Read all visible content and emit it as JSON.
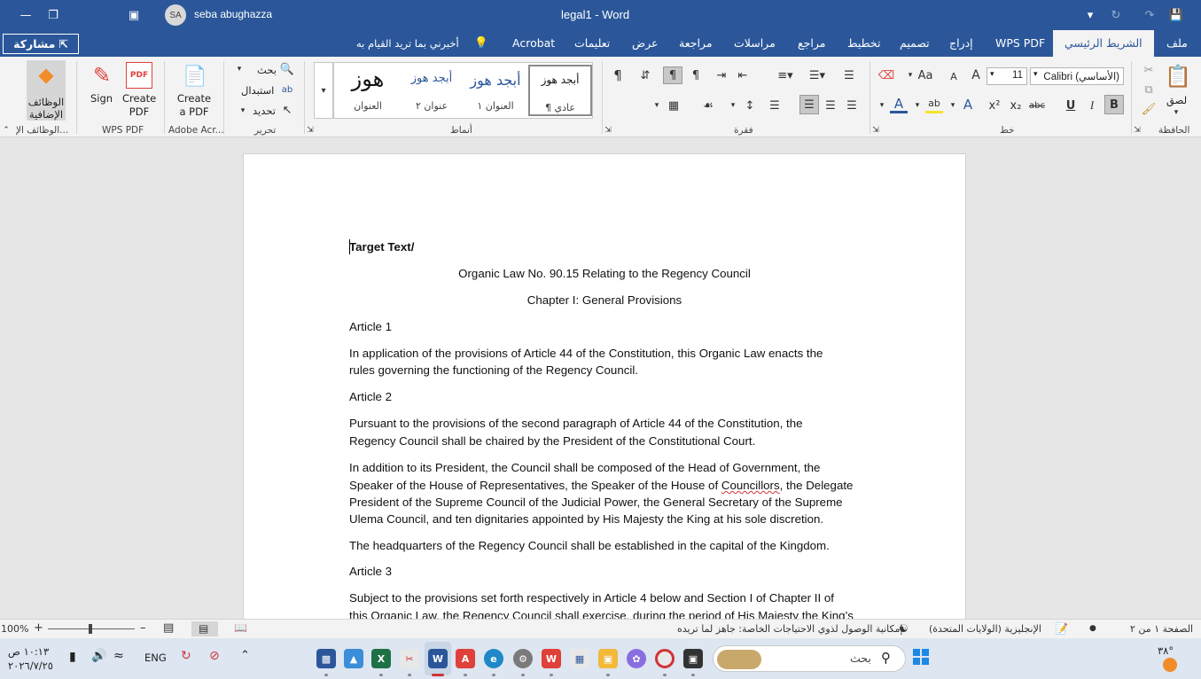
{
  "titlebar": {
    "user_initials": "SA",
    "user_name": "seba abughazza",
    "doc_title": "legal1  -  Word"
  },
  "tabs": {
    "file": "ملف",
    "home": "الشريط الرئيسي",
    "wps_pdf": "WPS PDF",
    "insert": "إدراج",
    "design": "تصميم",
    "layout": "تخطيط",
    "references": "مراجع",
    "mailings": "مراسلات",
    "review": "مراجعة",
    "view": "عرض",
    "help": "تعليمات",
    "acrobat": "Acrobat",
    "tell_me": "أخبرني بما تريد القيام به",
    "share": "مشاركة"
  },
  "ribbon": {
    "clipboard": {
      "paste": "لصق",
      "label": "الحافظة"
    },
    "font": {
      "font_name": "Calibri (الأساسي)",
      "font_size": "11",
      "label": "خط",
      "bold": "B",
      "italic": "I",
      "underline": "U",
      "strike": "abc",
      "subscript": "x₂",
      "superscript": "x²",
      "grow": "A",
      "shrink": "A",
      "case": "Aa"
    },
    "paragraph": {
      "label": "فقرة"
    },
    "styles": {
      "label": "أنماط",
      "items": [
        {
          "preview": "أبجد هوز",
          "name": "¶ عادي"
        },
        {
          "preview": "أبجد هوز",
          "name": "العنوان ١"
        },
        {
          "preview": "أبجد هوز",
          "name": "عنوان ٢"
        },
        {
          "preview": "هوز",
          "name": "العنوان"
        }
      ]
    },
    "editing": {
      "find": "بحث",
      "replace": "استبدال",
      "select": "تحديد",
      "label": "تحرير"
    },
    "adobe": {
      "create": "Create a PDF",
      "label": "Adobe Acr..."
    },
    "wps": {
      "sign": "Sign",
      "create": "Create PDF",
      "label": "WPS PDF"
    },
    "addins": {
      "button": "الوظائف الإضافية",
      "label": "الوظائف الإ..."
    }
  },
  "document": {
    "lines": [
      "Target Text/",
      "Organic Law No. 90.15 Relating to the Regency Council",
      "Chapter I: General Provisions",
      "Article 1",
      "In application of the provisions of Article 44 of the Constitution, this Organic Law enacts the",
      "rules governing the functioning of the Regency Council.",
      "Article 2",
      "Pursuant to the provisions of the second paragraph of Article 44 of the Constitution, the",
      "Regency Council shall be chaired by the President of the Constitutional Court.",
      "In addition to its President, the Council shall be composed of the Head of Government, the",
      "Speaker of the House of Representatives, the Speaker of the House of ",
      "Councillors",
      ", the Delegate",
      "President of the Supreme Council of the Judicial Power, the General Secretary of the Supreme",
      "Ulema Council, and ten dignitaries appointed by His Majesty the King at his sole discretion.",
      "The headquarters of the Regency Council shall be established in the capital of the Kingdom.",
      "Article 3",
      "Subject to the provisions set forth respectively in Article 4 below and Section I of Chapter II of",
      "this Organic Law, the Regency Council shall exercise, during the period of His Majesty the King’s"
    ]
  },
  "statusbar": {
    "page": "الصفحة ١ من ٢",
    "language": "الإنجليزية (الولايات المتحدة)",
    "accessibility": "إمكانية الوصول لذوي الاحتياجات الخاصة: جاهز لما تريده",
    "zoom": "100%"
  },
  "taskbar": {
    "search_placeholder": "بحث",
    "language": "ENG",
    "time": "١٠:١٣ ص",
    "date": "٢٠٢٦/٧/٢٥",
    "weather": "٣٨°"
  },
  "colors": {
    "accent": "#2b579a",
    "taskbar": "#dde6f1"
  }
}
